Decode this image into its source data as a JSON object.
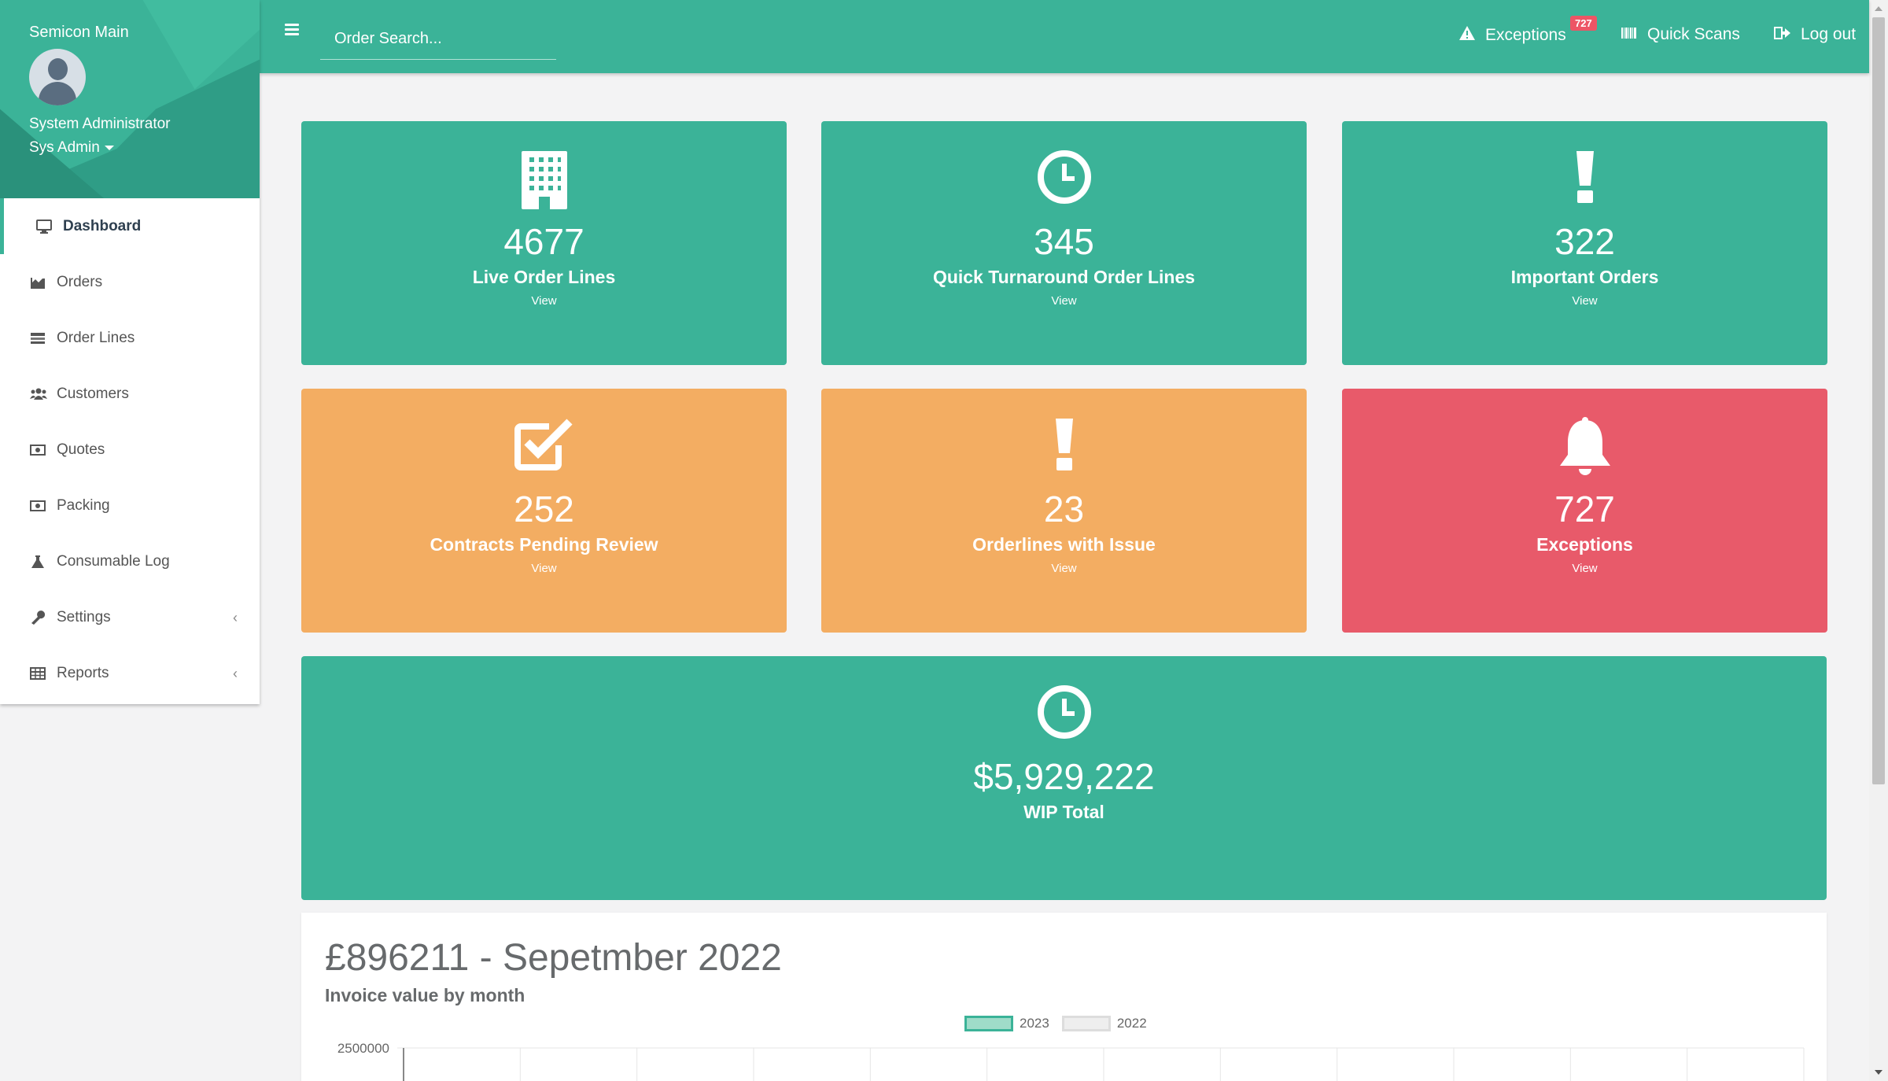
{
  "sidebar": {
    "site_name": "Semicon Main",
    "user_name": "System Administrator",
    "user_role": "Sys Admin",
    "items": [
      {
        "label": "Dashboard",
        "icon": "monitor-icon",
        "active": true
      },
      {
        "label": "Orders",
        "icon": "bar-chart-icon"
      },
      {
        "label": "Order Lines",
        "icon": "list-icon"
      },
      {
        "label": "Customers",
        "icon": "users-icon"
      },
      {
        "label": "Quotes",
        "icon": "money-icon"
      },
      {
        "label": "Packing",
        "icon": "money-icon"
      },
      {
        "label": "Consumable Log",
        "icon": "flask-icon"
      },
      {
        "label": "Settings",
        "icon": "wrench-icon",
        "expandable": true
      },
      {
        "label": "Reports",
        "icon": "table-icon",
        "expandable": true
      }
    ]
  },
  "topbar": {
    "search_placeholder": "Order Search...",
    "exceptions_label": "Exceptions",
    "exceptions_badge": "727",
    "quick_scans_label": "Quick Scans",
    "logout_label": "Log out"
  },
  "cards": [
    {
      "number": "4677",
      "label": "Live Order Lines",
      "view": "View",
      "icon": "building-icon",
      "color": "#3bb398"
    },
    {
      "number": "345",
      "label": "Quick Turnaround Order Lines",
      "view": "View",
      "icon": "clock-icon",
      "color": "#3bb398"
    },
    {
      "number": "322",
      "label": "Important Orders",
      "view": "View",
      "icon": "exclamation-icon",
      "color": "#3bb398"
    },
    {
      "number": "252",
      "label": "Contracts Pending Review",
      "view": "View",
      "icon": "checkbox-icon",
      "color": "#f3ad62"
    },
    {
      "number": "23",
      "label": "Orderlines with Issue",
      "view": "View",
      "icon": "exclamation-icon",
      "color": "#f3ad62"
    },
    {
      "number": "727",
      "label": "Exceptions",
      "view": "View",
      "icon": "bell-icon",
      "color": "#e85a6a"
    }
  ],
  "wip": {
    "number": "$5,929,222",
    "label": "WIP Total",
    "icon": "clock-icon"
  },
  "chart_panel": {
    "title": "£896211 - Sepetmber 2022",
    "subtitle": "Invoice value by month"
  },
  "chart_data": {
    "type": "bar",
    "title": "Invoice value by month",
    "series": [
      {
        "name": "2023",
        "color": "#9fdcc9",
        "values": []
      },
      {
        "name": "2022",
        "color": "#eeeeee",
        "values": []
      }
    ],
    "y_tick_labels": [
      "2500000"
    ],
    "legend_position": "top-center"
  }
}
